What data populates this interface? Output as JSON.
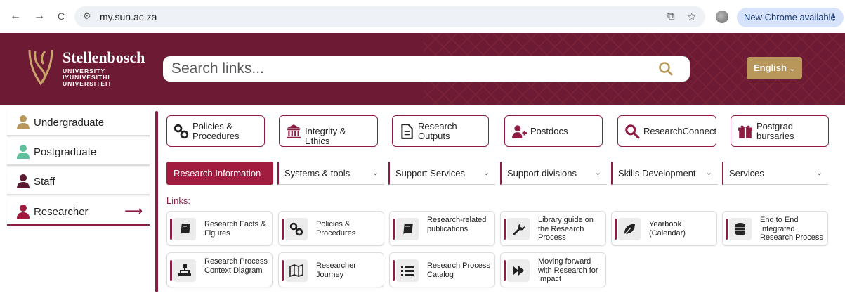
{
  "browser": {
    "back": "←",
    "forward": "→",
    "reload": "C",
    "url": "my.sun.ac.za",
    "new_chrome": "New Chrome available",
    "menu_dots": "⋮"
  },
  "header": {
    "brand_name": "Stellenbosch",
    "brand_sub_1": "UNIVERSITY",
    "brand_sub_2": "IYUNIVESITHI",
    "brand_sub_3": "UNIVERSITEIT",
    "search_placeholder": "Search links...",
    "language": "English",
    "language_caret": "⌄"
  },
  "sidebar": {
    "items": [
      {
        "label": "Undergraduate",
        "color": "#b9975b"
      },
      {
        "label": "Postgraduate",
        "color": "#5fbf9a"
      },
      {
        "label": "Staff",
        "color": "#5a1a2e"
      },
      {
        "label": "Researcher",
        "color": "#a11c3f"
      }
    ],
    "arrow": "⟶"
  },
  "quick_buttons": [
    {
      "label": "Policies & Procedures",
      "icon": "link-icon"
    },
    {
      "label": "Integrity & Ethics",
      "icon": "institution-icon"
    },
    {
      "label": "Research Outputs",
      "icon": "document-icon"
    },
    {
      "label": "Postdocs",
      "icon": "user-plus-icon"
    },
    {
      "label": "ResearchConnect",
      "icon": "search-icon"
    },
    {
      "label": "Postgrad bursaries",
      "icon": "gift-icon"
    }
  ],
  "tabs": [
    {
      "label": "Research Information"
    },
    {
      "label": "Systems & tools"
    },
    {
      "label": "Support Services"
    },
    {
      "label": "Support divisions"
    },
    {
      "label": "Skills Development"
    },
    {
      "label": "Services"
    }
  ],
  "chevron": "⌄",
  "links_heading": "Links:",
  "links": [
    {
      "label": "Research Facts & Figures",
      "icon": "book-icon"
    },
    {
      "label": "Policies & Procedures",
      "icon": "link-icon"
    },
    {
      "label": "Research-related publications",
      "icon": "book-icon"
    },
    {
      "label": "Library guide on the Research Process",
      "icon": "wrench-icon"
    },
    {
      "label": "Yearbook (Calendar)",
      "icon": "leaf-icon"
    },
    {
      "label": "End to End Integrated Research Process",
      "icon": "database-icon"
    },
    {
      "label": "Research Process Context Diagram",
      "icon": "sitemap-icon"
    },
    {
      "label": "Researcher Journey",
      "icon": "map-icon"
    },
    {
      "label": "Research Process Catalog",
      "icon": "list-icon"
    },
    {
      "label": "Moving forward with Research for Impact",
      "icon": "fast-forward-icon"
    }
  ],
  "colors": {
    "maroon": "#6d1a35",
    "accent": "#8c1d40",
    "gold": "#b9975b"
  }
}
